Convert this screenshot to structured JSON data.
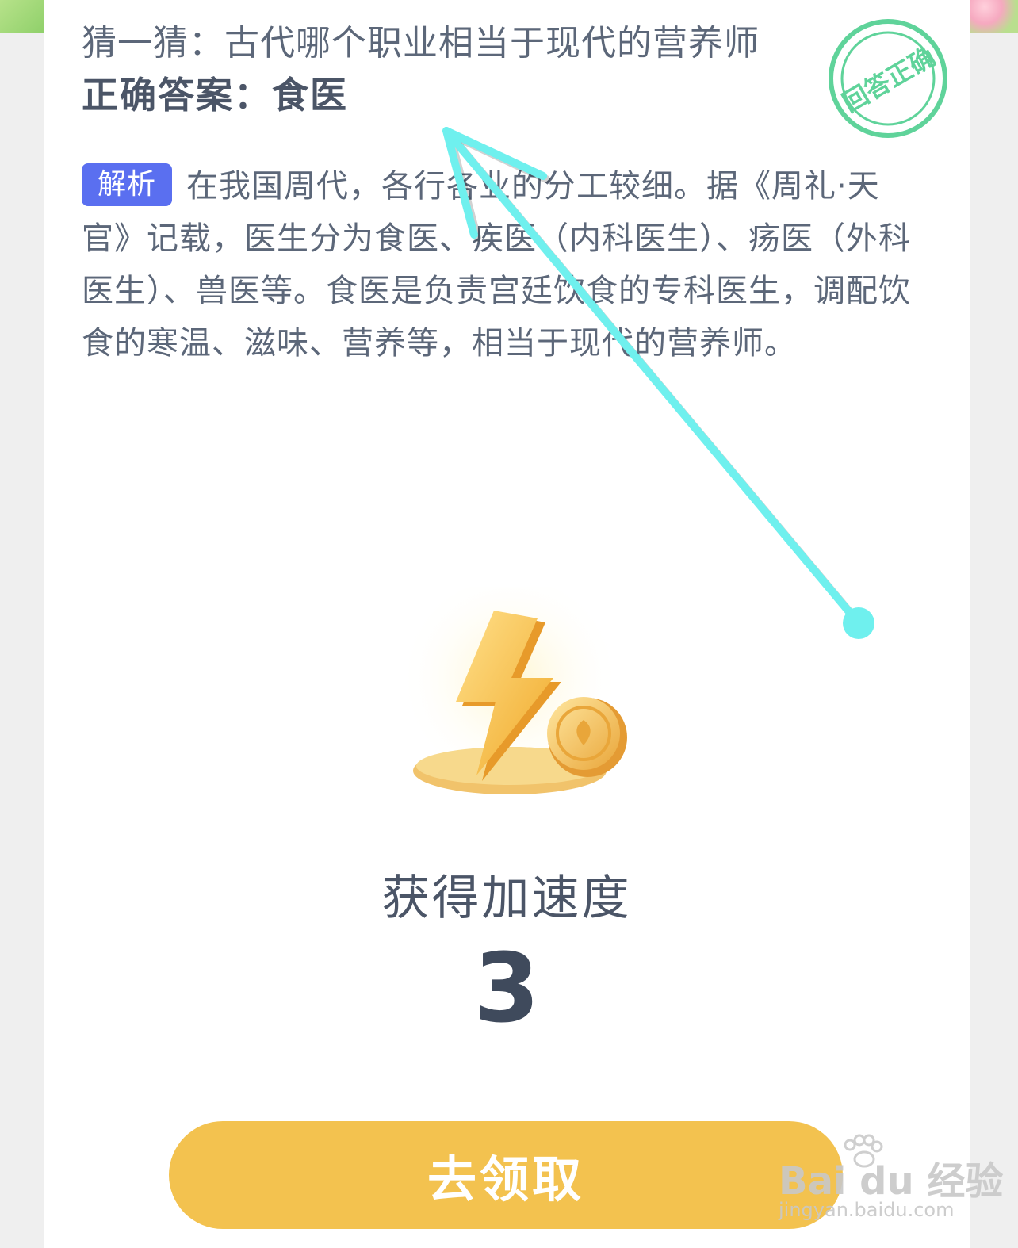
{
  "question": {
    "text": "猜一猜：古代哪个职业相当于现代的营养师",
    "answer": "正确答案：食医"
  },
  "stamp": {
    "text": "回答正确"
  },
  "analysis": {
    "badge": "解析",
    "text": "在我国周代，各行各业的分工较细。据《周礼·天官》记载，医生分为食医、疾医（内科医生）、疡医（外科医生）、兽医等。食医是负责宫廷饮食的专科医生，调配饮食的寒温、滋味、营养等，相当于现代的营养师。"
  },
  "reward": {
    "label": "获得加速度",
    "value": "3",
    "icon": "lightning-coin-icon"
  },
  "claim_button": {
    "label": "去领取"
  },
  "watermark": {
    "main": "Bai du 经验",
    "sub": "jingyan.baidu.com"
  },
  "colors": {
    "badge": "#5a6ff0",
    "button": "#f3c24f",
    "stamp": "#5fd39a",
    "arrow": "#6ff0ee"
  }
}
